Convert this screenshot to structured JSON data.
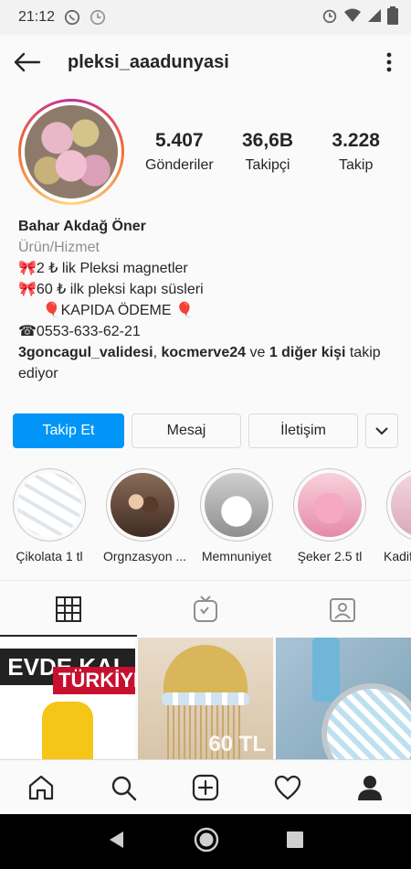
{
  "status_bar": {
    "time": "21:12"
  },
  "header": {
    "username": "pleksi_aaadunyasi"
  },
  "profile": {
    "stats": [
      {
        "value": "5.407",
        "label": "Gönderiler"
      },
      {
        "value": "36,6B",
        "label": "Takipçi"
      },
      {
        "value": "3.228",
        "label": "Takip"
      }
    ],
    "name": "Bahar Akdağ Öner",
    "category": "Ürün/Hizmet",
    "bio_lines": [
      "🎀2 ₺ lik  Pleksi magnetler",
      "🎀60 ₺ ilk pleksi kapı süsleri",
      "      🎈KAPIDA ÖDEME 🎈",
      "☎0553-633-62-21"
    ],
    "followed_by": {
      "user1": "3goncagul_validesi",
      "sep": ", ",
      "user2": "kocmerve24",
      "mid": " ve ",
      "others": "1 diğer kişi",
      "tail1": " takip",
      "tail2": "ediyor"
    }
  },
  "actions": {
    "follow": "Takip Et",
    "message": "Mesaj",
    "contact": "İletişim"
  },
  "highlights": [
    {
      "label": "Çikolata 1 tl"
    },
    {
      "label": "Orgnzasyon ..."
    },
    {
      "label": "Memnuniyet"
    },
    {
      "label": "Şeker  2.5 tl"
    },
    {
      "label": "Kadif"
    }
  ],
  "grid": {
    "post1_line1": "EVDE KAL",
    "post1_line2": "TÜRKİYE!",
    "post2_overlay": "60 TL"
  }
}
